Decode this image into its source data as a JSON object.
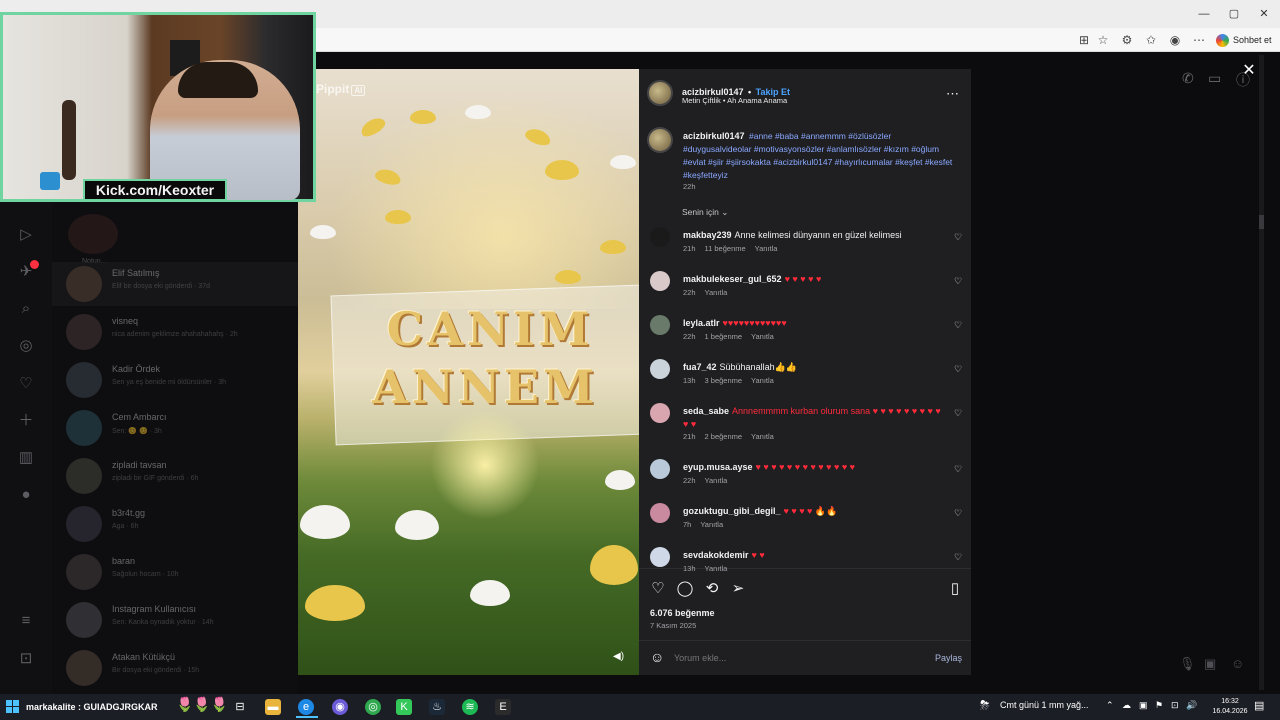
{
  "browser": {
    "sohbet_label": "Sohbet et",
    "window_controls": [
      "minimize",
      "restore",
      "close"
    ],
    "toolbar_icons": [
      "apps-icon",
      "star-icon",
      "extensions-icon",
      "favorites-icon",
      "profile-icon",
      "more-icon"
    ]
  },
  "stream_overlay": {
    "kick_label": "Kick.com/Keoxter",
    "bottom_text": "markakalite : GUIADGJRGKAR"
  },
  "sidebar_nav": [
    "reels-icon",
    "messages-icon",
    "search-icon",
    "explore-icon",
    "heart-icon",
    "create-icon",
    "dashboard-icon",
    "profile-icon",
    "menu-icon",
    "threads-icon"
  ],
  "conversations": [
    {
      "name": "Elif Satılmış",
      "preview": "Elif bir dosya eki gönderdi · 37d"
    },
    {
      "name": "visneq",
      "preview": "nica adenim geklimze ahahahahahş · 2h"
    },
    {
      "name": "Kadir Ördek",
      "preview": "Sen ya eş benide mi öldürsünler · 3h"
    },
    {
      "name": "Cem Ambarcı",
      "preview": "Sen: 😊 😊 · 3h"
    },
    {
      "name": "zipladi tavsan",
      "preview": "zipladi bir GIF gönderdi · 6h"
    },
    {
      "name": "b3r4t.gg",
      "preview": "Aga · 6h"
    },
    {
      "name": "baran",
      "preview": "Sağolun hocam · 10h"
    },
    {
      "name": "Instagram Kullanıcısı",
      "preview": "Sen: Kankа oynadık yoktur · 14h"
    },
    {
      "name": "Atakan Kütükçü",
      "preview": "Bir dosya eki gönderdi · 15h"
    }
  ],
  "conversation_top_label": "Notun...",
  "media": {
    "watermark": "Pippit",
    "watermark_badge": "AI",
    "banner_line1": "CANIM",
    "banner_line2": "ANNEM"
  },
  "post": {
    "username": "acizbirkul0147",
    "follow": "Takip Et",
    "audio": "Metin Çiftlik • Ah Anama Anama",
    "caption_user": "acizbirkul0147",
    "caption_tags": "#anne #baba #annemmm #özlüsözler #duygusalvideolar #motivasyonsözler #anlamlısözler #kızım #oğlum #evlat #şiir #şiirsokakta #acizbirkul0147 #hayırlıcumalar #keşfet #kesfet #keşfetteyiz",
    "caption_time": "22h",
    "sort_label": "Senin için",
    "likes": "6.076 beğenme",
    "date": "7 Kasım 2025",
    "comment_placeholder": "Yorum ekle...",
    "share_label": "Paylaş"
  },
  "comments": [
    {
      "user": "makbay239",
      "text": "Anne kelimesi dünyanın en güzel kelimesi",
      "time": "21h",
      "likes": "11 beğenme",
      "reply": "Yanıtla"
    },
    {
      "user": "makbulekeser_gul_652",
      "text": "♥ ♥ ♥ ♥ ♥",
      "time": "22h",
      "likes": "",
      "reply": "Yanıtla"
    },
    {
      "user": "leyla.atlr",
      "text": "♥♥♥♥♥♥♥♥♥♥♥♥",
      "time": "22h",
      "likes": "1 beğenme",
      "reply": "Yanıtla"
    },
    {
      "user": "fua7_42",
      "text": "Sübühanallah👍👍",
      "time": "13h",
      "likes": "3 beğenme",
      "reply": "Yanıtla"
    },
    {
      "user": "seda_sabe",
      "text": "Annnemmmm kurban olurum sana ♥ ♥ ♥ ♥ ♥ ♥ ♥ ♥ ♥ ♥ ♥",
      "time": "21h",
      "likes": "2 beğenme",
      "reply": "Yanıtla"
    },
    {
      "user": "eyup.musa.ayse",
      "text": "♥ ♥ ♥ ♥ ♥ ♥ ♥ ♥ ♥ ♥ ♥ ♥ ♥",
      "time": "22h",
      "likes": "",
      "reply": "Yanıtla"
    },
    {
      "user": "gozuktugu_gibi_degil_",
      "text": "♥ ♥ ♥ ♥ 🔥🔥",
      "time": "7h",
      "likes": "",
      "reply": "Yanıtla"
    },
    {
      "user": "sevdakokdemir",
      "text": "♥ ♥",
      "time": "13h",
      "likes": "",
      "reply": "Yanıtla"
    }
  ],
  "taskbar": {
    "weather": "Cmt günü 1 mm yağ...",
    "time": "16:32",
    "date": "16.04.2026"
  }
}
